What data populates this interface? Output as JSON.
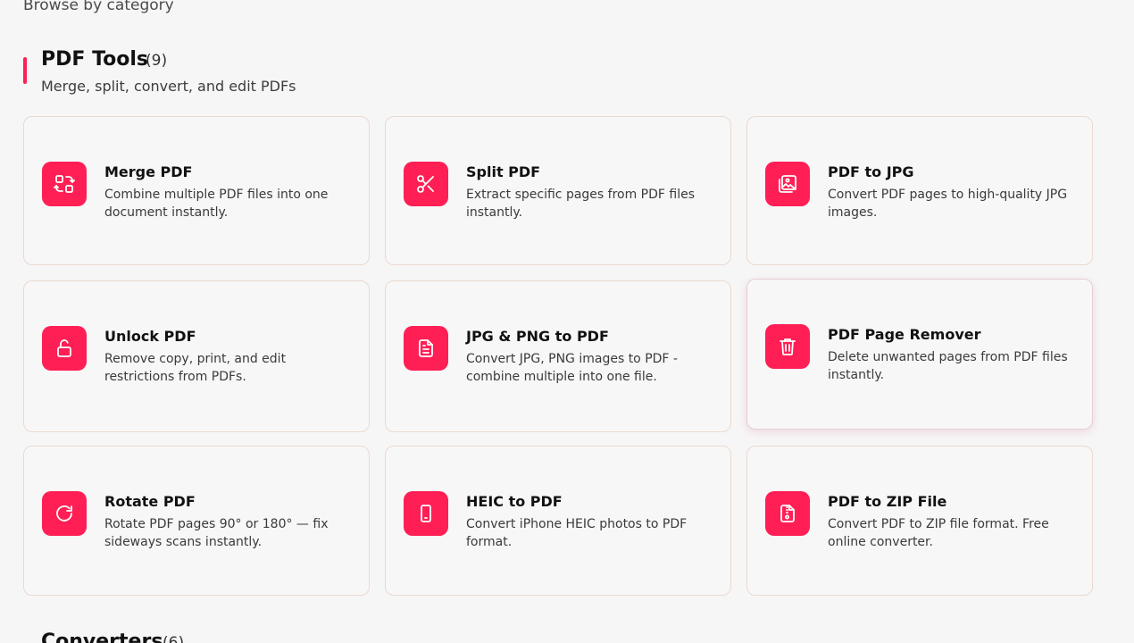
{
  "browse_label": "Browse by category",
  "section": {
    "title": "PDF Tools",
    "count": "(9)",
    "subtitle": "Merge, split, convert, and edit PDFs"
  },
  "accent_color": "#ff1f55",
  "tools": [
    {
      "title": "Merge PDF",
      "desc": "Combine multiple PDF files into one document instantly.",
      "icon": "merge-icon"
    },
    {
      "title": "Split PDF",
      "desc": "Extract specific pages from PDF files instantly.",
      "icon": "scissors-icon"
    },
    {
      "title": "PDF to JPG",
      "desc": "Convert PDF pages to high-quality JPG images.",
      "icon": "image-icon"
    },
    {
      "title": "Unlock PDF",
      "desc": "Remove copy, print, and edit restrictions from PDFs.",
      "icon": "unlock-icon"
    },
    {
      "title": "JPG & PNG to PDF",
      "desc": "Convert JPG, PNG images to PDF - combine multiple into one file.",
      "icon": "document-icon"
    },
    {
      "title": "PDF Page Remover",
      "desc": "Delete unwanted pages from PDF files instantly.",
      "icon": "trash-icon"
    },
    {
      "title": "Rotate PDF",
      "desc": "Rotate PDF pages 90° or 180° — fix sideways scans instantly.",
      "icon": "rotate-icon"
    },
    {
      "title": "HEIC to PDF",
      "desc": "Convert iPhone HEIC photos to PDF format.",
      "icon": "phone-icon"
    },
    {
      "title": "PDF to ZIP File",
      "desc": "Convert PDF to ZIP file format. Free online converter.",
      "icon": "zip-file-icon"
    }
  ],
  "next_section": {
    "title": "Converters",
    "count": "(6)"
  }
}
